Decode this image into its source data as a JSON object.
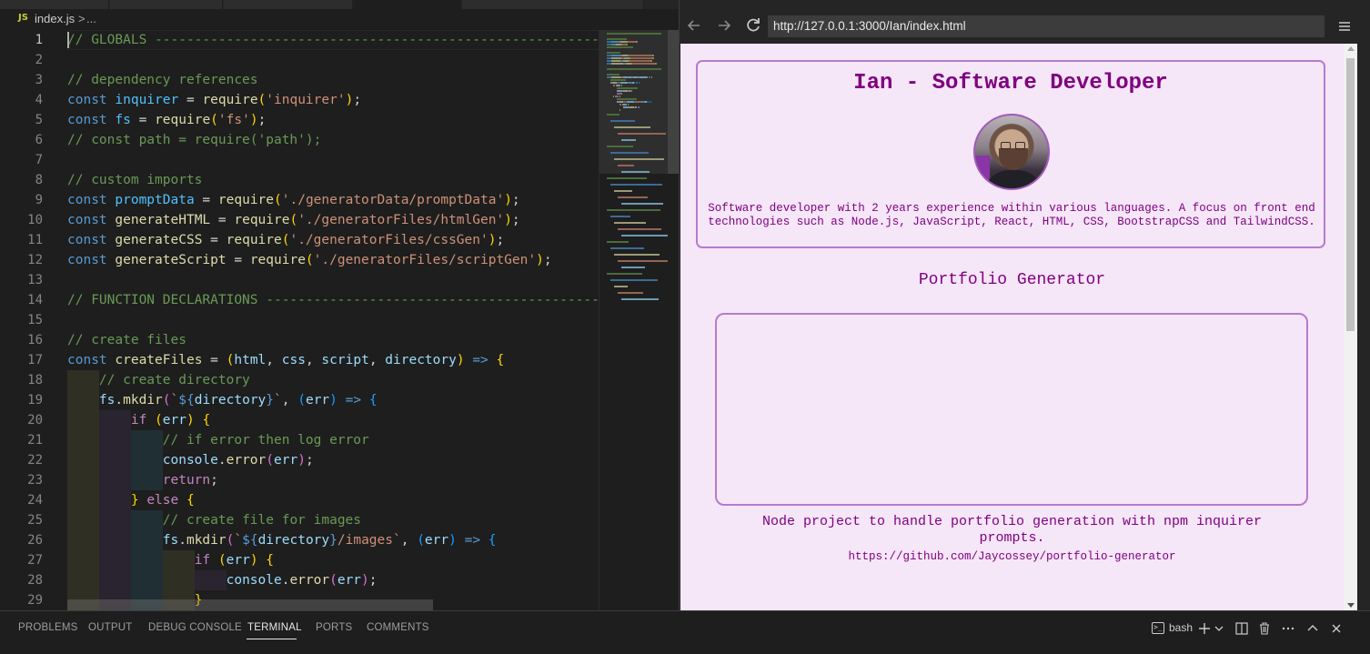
{
  "editor": {
    "breadcrumb": {
      "file_badge": "JS",
      "file": "index.js",
      "separator": ">",
      "more": "..."
    },
    "lines": [
      {
        "n": "1",
        "parts": [
          [
            "cm",
            "// GLOBALS ---------------------------------------------------------------"
          ]
        ]
      },
      {
        "n": "2",
        "parts": []
      },
      {
        "n": "3",
        "parts": [
          [
            "cm",
            "// dependency references"
          ]
        ]
      },
      {
        "n": "4",
        "parts": [
          [
            "kw",
            "const "
          ],
          [
            "cst",
            "inquirer"
          ],
          [
            "plain",
            " = "
          ],
          [
            "fn",
            "require"
          ],
          [
            "b1",
            "("
          ],
          [
            "str",
            "'inquirer'"
          ],
          [
            "b1",
            ")"
          ],
          [
            "plain",
            ";"
          ]
        ]
      },
      {
        "n": "5",
        "parts": [
          [
            "kw",
            "const "
          ],
          [
            "cst",
            "fs"
          ],
          [
            "plain",
            " = "
          ],
          [
            "fn",
            "require"
          ],
          [
            "b1",
            "("
          ],
          [
            "str",
            "'fs'"
          ],
          [
            "b1",
            ")"
          ],
          [
            "plain",
            ";"
          ]
        ]
      },
      {
        "n": "6",
        "parts": [
          [
            "cm",
            "// const path = require('path');"
          ]
        ]
      },
      {
        "n": "7",
        "parts": []
      },
      {
        "n": "8",
        "parts": [
          [
            "cm",
            "// custom imports"
          ]
        ]
      },
      {
        "n": "9",
        "parts": [
          [
            "kw",
            "const "
          ],
          [
            "cst",
            "promptData"
          ],
          [
            "plain",
            " = "
          ],
          [
            "fn",
            "require"
          ],
          [
            "b1",
            "("
          ],
          [
            "str",
            "'./generatorData/promptData'"
          ],
          [
            "b1",
            ")"
          ],
          [
            "plain",
            ";"
          ]
        ]
      },
      {
        "n": "10",
        "parts": [
          [
            "kw",
            "const "
          ],
          [
            "fn",
            "generateHTML"
          ],
          [
            "plain",
            " = "
          ],
          [
            "fn",
            "require"
          ],
          [
            "b1",
            "("
          ],
          [
            "str",
            "'./generatorFiles/htmlGen'"
          ],
          [
            "b1",
            ")"
          ],
          [
            "plain",
            ";"
          ]
        ]
      },
      {
        "n": "11",
        "parts": [
          [
            "kw",
            "const "
          ],
          [
            "fn",
            "generateCSS"
          ],
          [
            "plain",
            " = "
          ],
          [
            "fn",
            "require"
          ],
          [
            "b1",
            "("
          ],
          [
            "str",
            "'./generatorFiles/cssGen'"
          ],
          [
            "b1",
            ")"
          ],
          [
            "plain",
            ";"
          ]
        ]
      },
      {
        "n": "12",
        "parts": [
          [
            "kw",
            "const "
          ],
          [
            "fn",
            "generateScript"
          ],
          [
            "plain",
            " = "
          ],
          [
            "fn",
            "require"
          ],
          [
            "b1",
            "("
          ],
          [
            "str",
            "'./generatorFiles/scriptGen'"
          ],
          [
            "b1",
            ")"
          ],
          [
            "plain",
            ";"
          ]
        ]
      },
      {
        "n": "13",
        "parts": []
      },
      {
        "n": "14",
        "parts": [
          [
            "cm",
            "// FUNCTION DECLARATIONS ---------------------------------------------------"
          ]
        ]
      },
      {
        "n": "15",
        "parts": []
      },
      {
        "n": "16",
        "parts": [
          [
            "cm",
            "// create files"
          ]
        ]
      },
      {
        "n": "17",
        "parts": [
          [
            "kw",
            "const "
          ],
          [
            "fn",
            "createFiles"
          ],
          [
            "plain",
            " = "
          ],
          [
            "b1",
            "("
          ],
          [
            "var",
            "html"
          ],
          [
            "plain",
            ", "
          ],
          [
            "var",
            "css"
          ],
          [
            "plain",
            ", "
          ],
          [
            "var",
            "script"
          ],
          [
            "plain",
            ", "
          ],
          [
            "var",
            "directory"
          ],
          [
            "b1",
            ")"
          ],
          [
            "plain",
            " "
          ],
          [
            "kw",
            "=>"
          ],
          [
            "plain",
            " "
          ],
          [
            "b1",
            "{"
          ]
        ]
      },
      {
        "n": "18",
        "parts": [
          [
            "plain",
            "    "
          ],
          [
            "cm",
            "// create directory"
          ]
        ]
      },
      {
        "n": "19",
        "parts": [
          [
            "plain",
            "    "
          ],
          [
            "var",
            "fs"
          ],
          [
            "plain",
            "."
          ],
          [
            "fn",
            "mkdir"
          ],
          [
            "b2",
            "("
          ],
          [
            "str",
            "`"
          ],
          [
            "kw",
            "${"
          ],
          [
            "var",
            "directory"
          ],
          [
            "kw",
            "}"
          ],
          [
            "str",
            "`"
          ],
          [
            "plain",
            ", "
          ],
          [
            "b3",
            "("
          ],
          [
            "var",
            "err"
          ],
          [
            "b3",
            ")"
          ],
          [
            "plain",
            " "
          ],
          [
            "kw",
            "=>"
          ],
          [
            "plain",
            " "
          ],
          [
            "b3",
            "{"
          ]
        ]
      },
      {
        "n": "20",
        "parts": [
          [
            "plain",
            "        "
          ],
          [
            "kw2",
            "if"
          ],
          [
            "plain",
            " "
          ],
          [
            "b1",
            "("
          ],
          [
            "var",
            "err"
          ],
          [
            "b1",
            ")"
          ],
          [
            "plain",
            " "
          ],
          [
            "b1",
            "{"
          ]
        ]
      },
      {
        "n": "21",
        "parts": [
          [
            "plain",
            "            "
          ],
          [
            "cm",
            "// if error then log error"
          ]
        ]
      },
      {
        "n": "22",
        "parts": [
          [
            "plain",
            "            "
          ],
          [
            "var",
            "console"
          ],
          [
            "plain",
            "."
          ],
          [
            "fn",
            "error"
          ],
          [
            "b2",
            "("
          ],
          [
            "var",
            "err"
          ],
          [
            "b2",
            ")"
          ],
          [
            "plain",
            ";"
          ]
        ]
      },
      {
        "n": "23",
        "parts": [
          [
            "plain",
            "            "
          ],
          [
            "kw2",
            "return"
          ],
          [
            "plain",
            ";"
          ]
        ]
      },
      {
        "n": "24",
        "parts": [
          [
            "plain",
            "        "
          ],
          [
            "b1",
            "}"
          ],
          [
            "plain",
            " "
          ],
          [
            "kw2",
            "else"
          ],
          [
            "plain",
            " "
          ],
          [
            "b1",
            "{"
          ]
        ]
      },
      {
        "n": "25",
        "parts": [
          [
            "plain",
            "            "
          ],
          [
            "cm",
            "// create file for images"
          ]
        ]
      },
      {
        "n": "26",
        "parts": [
          [
            "plain",
            "            "
          ],
          [
            "var",
            "fs"
          ],
          [
            "plain",
            "."
          ],
          [
            "fn",
            "mkdir"
          ],
          [
            "b2",
            "("
          ],
          [
            "str",
            "`"
          ],
          [
            "kw",
            "${"
          ],
          [
            "var",
            "directory"
          ],
          [
            "kw",
            "}"
          ],
          [
            "str",
            "/images`"
          ],
          [
            "plain",
            ", "
          ],
          [
            "b3",
            "("
          ],
          [
            "var",
            "err"
          ],
          [
            "b3",
            ")"
          ],
          [
            "plain",
            " "
          ],
          [
            "kw",
            "=>"
          ],
          [
            "plain",
            " "
          ],
          [
            "b3",
            "{"
          ]
        ]
      },
      {
        "n": "27",
        "parts": [
          [
            "plain",
            "                "
          ],
          [
            "kw2",
            "if"
          ],
          [
            "plain",
            " "
          ],
          [
            "b1",
            "("
          ],
          [
            "var",
            "err"
          ],
          [
            "b1",
            ")"
          ],
          [
            "plain",
            " "
          ],
          [
            "b1",
            "{"
          ]
        ]
      },
      {
        "n": "28",
        "parts": [
          [
            "plain",
            "                    "
          ],
          [
            "var",
            "console"
          ],
          [
            "plain",
            "."
          ],
          [
            "fn",
            "error"
          ],
          [
            "b2",
            "("
          ],
          [
            "var",
            "err"
          ],
          [
            "b2",
            ")"
          ],
          [
            "plain",
            ";"
          ]
        ]
      },
      {
        "n": "29",
        "parts": [
          [
            "plain",
            "                "
          ],
          [
            "b1",
            "}"
          ]
        ]
      }
    ],
    "colors": {
      "comment": "#6a9955",
      "keyword": "#569cd6",
      "control": "#c586c0",
      "variable": "#9cdcfe",
      "constant": "#4fc1ff",
      "function": "#dcdcaa",
      "string": "#ce9178"
    }
  },
  "browser": {
    "url": "http://127.0.0.1:3000/Ian/index.html",
    "icons": [
      "back-arrow-icon",
      "forward-arrow-icon",
      "reload-icon",
      "menu-icon"
    ],
    "page": {
      "title": "Ian - Software Developer",
      "bio": "Software developer with 2 years experience within various languages. A focus on front end technologies such as Node.js, JavaScript, React, HTML, CSS, BootstrapCSS and TailwindCSS.",
      "section_title": "Portfolio Generator",
      "project_description": "Node project to handle portfolio generation with npm inquirer prompts.",
      "project_link": "https://github.com/Jaycossey/portfolio-generator",
      "colors": {
        "background": "#f5e6f8",
        "text": "#800080",
        "border": "#b57ccb"
      }
    }
  },
  "panel": {
    "tabs": [
      "PROBLEMS",
      "OUTPUT",
      "DEBUG CONSOLE",
      "TERMINAL",
      "PORTS",
      "COMMENTS"
    ],
    "active_tab": "TERMINAL",
    "terminal_name": "bash",
    "icons": [
      "terminal-icon",
      "add-terminal-icon",
      "chevron-down-icon",
      "split-terminal-icon",
      "trash-icon",
      "more-actions-icon",
      "maximize-panel-icon",
      "close-panel-icon"
    ]
  }
}
